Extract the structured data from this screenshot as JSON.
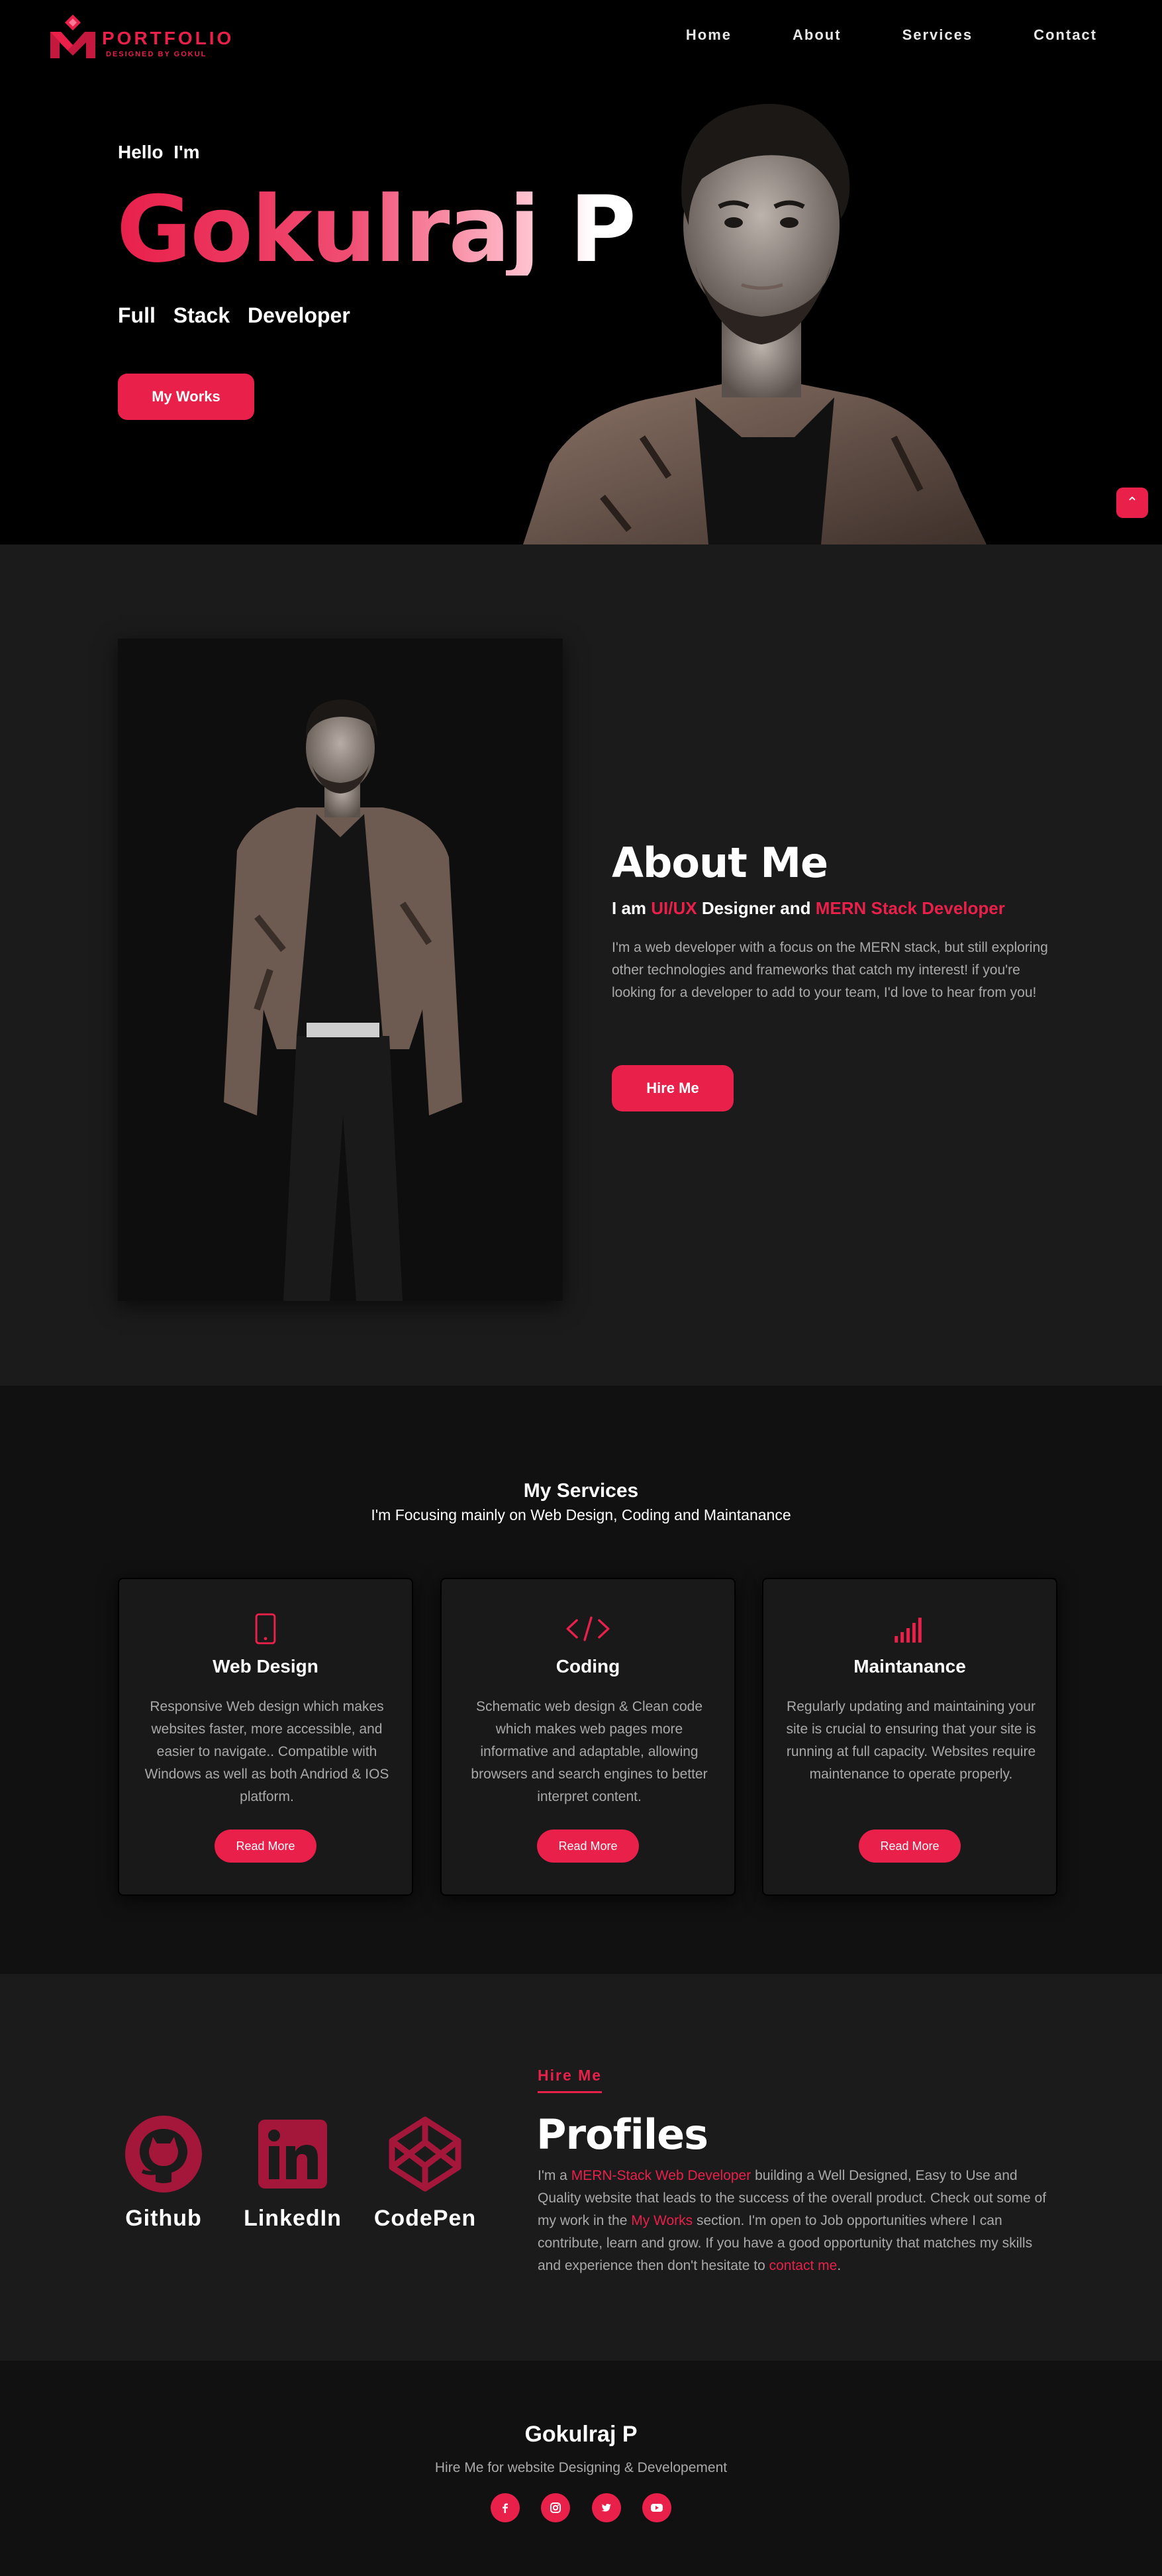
{
  "brand": {
    "name": "PORTFOLIO",
    "tagline": "DESIGNED BY GOKUL",
    "accent_color": "#e8204a"
  },
  "nav": {
    "items": [
      {
        "label": "Home"
      },
      {
        "label": "About"
      },
      {
        "label": "Services"
      },
      {
        "label": "Contact"
      }
    ]
  },
  "hero": {
    "greeting": "Hello  I'm",
    "name": "Gokulraj P",
    "role": "Full  Stack  Developer",
    "cta_label": "My Works",
    "scroll_top_icon": "chevron-up-icon"
  },
  "about": {
    "title": "About Me",
    "subtitle_prefix": "I am ",
    "subtitle_hl1": "UI/UX",
    "subtitle_mid": " Designer and ",
    "subtitle_hl2": "MERN Stack Developer",
    "text": "I'm a web developer with a focus on the MERN stack, but still exploring other technologies and frameworks that catch my interest! if you're looking for a developer to add to your team, I'd love to hear from you!",
    "cta_label": "Hire Me"
  },
  "services": {
    "title": "My Services",
    "subtitle": "I'm Focusing mainly on Web Design, Coding and Maintanance",
    "cards": [
      {
        "icon": "mobile-icon",
        "title": "Web Design",
        "text": "Responsive Web design which makes websites faster, more accessible, and easier to navigate.. Compatible with Windows as well as both Andriod & IOS platform.",
        "button": "Read More"
      },
      {
        "icon": "code-icon",
        "title": "Coding",
        "text": "Schematic web design & Clean code which makes web pages more informative and adaptable, allowing browsers and search engines to better interpret content.",
        "button": "Read More"
      },
      {
        "icon": "signal-icon",
        "title": "Maintanance",
        "text": "Regularly updating and maintaining your site is crucial to ensuring that your site is running at full capacity. Websites require maintenance to operate properly.",
        "button": "Read More"
      }
    ]
  },
  "profiles": {
    "tag": "Hire Me",
    "title": "Profiles",
    "links": [
      {
        "icon": "github-icon",
        "label": "Github"
      },
      {
        "icon": "linkedin-icon",
        "label": "LinkedIn"
      },
      {
        "icon": "codepen-icon",
        "label": "CodePen"
      }
    ],
    "text_1": "I'm a ",
    "text_hl1": "MERN-Stack Web Developer",
    "text_2": " building a Well Designed, Easy to Use and Quality website that leads to the success of the overall product. Check out some of my work in the ",
    "text_hl2": "My Works",
    "text_3": " section. I'm open to Job opportunities where I can contribute, learn and grow. If you have a good opportunity that matches my skills and experience then don't hesitate to ",
    "text_hl3": "contact me",
    "text_4": "."
  },
  "footer": {
    "name": "Gokulraj P",
    "subtitle": "Hire Me for website Designing & Developement",
    "icons": [
      "facebook-icon",
      "instagram-icon",
      "twitter-icon",
      "youtube-icon"
    ]
  }
}
